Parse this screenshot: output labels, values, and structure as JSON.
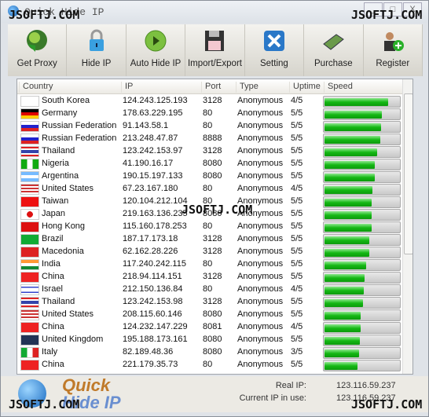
{
  "window": {
    "title": "Quick Hide IP",
    "controls": [
      "_",
      "□",
      "X"
    ]
  },
  "watermark": "JSOFTJ.COM",
  "toolbar": [
    {
      "label": "Get Proxy",
      "icon": "globe-download-icon"
    },
    {
      "label": "Hide IP",
      "icon": "lock-icon"
    },
    {
      "label": "Auto Hide IP",
      "icon": "play-icon"
    },
    {
      "label": "Import/Export",
      "icon": "floppy-disk-icon"
    },
    {
      "label": "Setting",
      "icon": "tools-icon"
    },
    {
      "label": "Purchase",
      "icon": "money-icon"
    },
    {
      "label": "Register",
      "icon": "user-add-icon"
    }
  ],
  "columns": [
    "Country",
    "IP",
    "Port",
    "Type",
    "Uptime",
    "Speed"
  ],
  "rows": [
    {
      "country": "South Korea",
      "ip": "124.243.125.193",
      "port": "3128",
      "type": "Anonymous",
      "uptime": "4/5",
      "speed": 0.83
    },
    {
      "country": "Germany",
      "ip": "178.63.229.195",
      "port": "80",
      "type": "Anonymous",
      "uptime": "5/5",
      "speed": 0.75
    },
    {
      "country": "Russian Federation",
      "ip": "91.143.58.1",
      "port": "80",
      "type": "Anonymous",
      "uptime": "5/5",
      "speed": 0.74
    },
    {
      "country": "Russian Federation",
      "ip": "213.248.47.87",
      "port": "8888",
      "type": "Anonymous",
      "uptime": "5/5",
      "speed": 0.73
    },
    {
      "country": "Thailand",
      "ip": "123.242.153.97",
      "port": "3128",
      "type": "Anonymous",
      "uptime": "5/5",
      "speed": 0.69
    },
    {
      "country": "Nigeria",
      "ip": "41.190.16.17",
      "port": "8080",
      "type": "Anonymous",
      "uptime": "5/5",
      "speed": 0.66
    },
    {
      "country": "Argentina",
      "ip": "190.15.197.133",
      "port": "8080",
      "type": "Anonymous",
      "uptime": "5/5",
      "speed": 0.66
    },
    {
      "country": "United States",
      "ip": "67.23.167.180",
      "port": "80",
      "type": "Anonymous",
      "uptime": "4/5",
      "speed": 0.63
    },
    {
      "country": "Taiwan",
      "ip": "120.104.212.104",
      "port": "80",
      "type": "Anonymous",
      "uptime": "5/5",
      "speed": 0.62
    },
    {
      "country": "Japan",
      "ip": "219.163.136.235",
      "port": "8080",
      "type": "Anonymous",
      "uptime": "5/5",
      "speed": 0.62
    },
    {
      "country": "Hong Kong",
      "ip": "115.160.178.253",
      "port": "80",
      "type": "Anonymous",
      "uptime": "5/5",
      "speed": 0.62
    },
    {
      "country": "Brazil",
      "ip": "187.17.173.18",
      "port": "3128",
      "type": "Anonymous",
      "uptime": "5/5",
      "speed": 0.59
    },
    {
      "country": "Macedonia",
      "ip": "62.162.28.226",
      "port": "3128",
      "type": "Anonymous",
      "uptime": "5/5",
      "speed": 0.59
    },
    {
      "country": "India",
      "ip": "117.240.242.115",
      "port": "80",
      "type": "Anonymous",
      "uptime": "5/5",
      "speed": 0.55
    },
    {
      "country": "China",
      "ip": "218.94.114.151",
      "port": "3128",
      "type": "Anonymous",
      "uptime": "5/5",
      "speed": 0.53
    },
    {
      "country": "Israel",
      "ip": "212.150.136.84",
      "port": "80",
      "type": "Anonymous",
      "uptime": "4/5",
      "speed": 0.52
    },
    {
      "country": "Thailand",
      "ip": "123.242.153.98",
      "port": "3128",
      "type": "Anonymous",
      "uptime": "5/5",
      "speed": 0.51
    },
    {
      "country": "United States",
      "ip": "208.115.60.146",
      "port": "8080",
      "type": "Anonymous",
      "uptime": "5/5",
      "speed": 0.47
    },
    {
      "country": "China",
      "ip": "124.232.147.229",
      "port": "8081",
      "type": "Anonymous",
      "uptime": "4/5",
      "speed": 0.47
    },
    {
      "country": "United Kingdom",
      "ip": "195.188.173.161",
      "port": "8080",
      "type": "Anonymous",
      "uptime": "5/5",
      "speed": 0.46
    },
    {
      "country": "Italy",
      "ip": "82.189.48.36",
      "port": "8080",
      "type": "Anonymous",
      "uptime": "3/5",
      "speed": 0.45
    },
    {
      "country": "China",
      "ip": "221.179.35.73",
      "port": "80",
      "type": "Anonymous",
      "uptime": "5/5",
      "speed": 0.43
    }
  ],
  "footer": {
    "logo_line1": "Quick",
    "logo_line2": "Hide IP",
    "real_ip_label": "Real IP:",
    "real_ip": "123.116.59.237",
    "current_ip_label": "Current IP in use:",
    "current_ip": "123.116.59.237"
  },
  "colors": {
    "speed_fill": "#14b814",
    "logo_orange": "#c07a2a",
    "logo_blue": "#6a8fd0"
  }
}
